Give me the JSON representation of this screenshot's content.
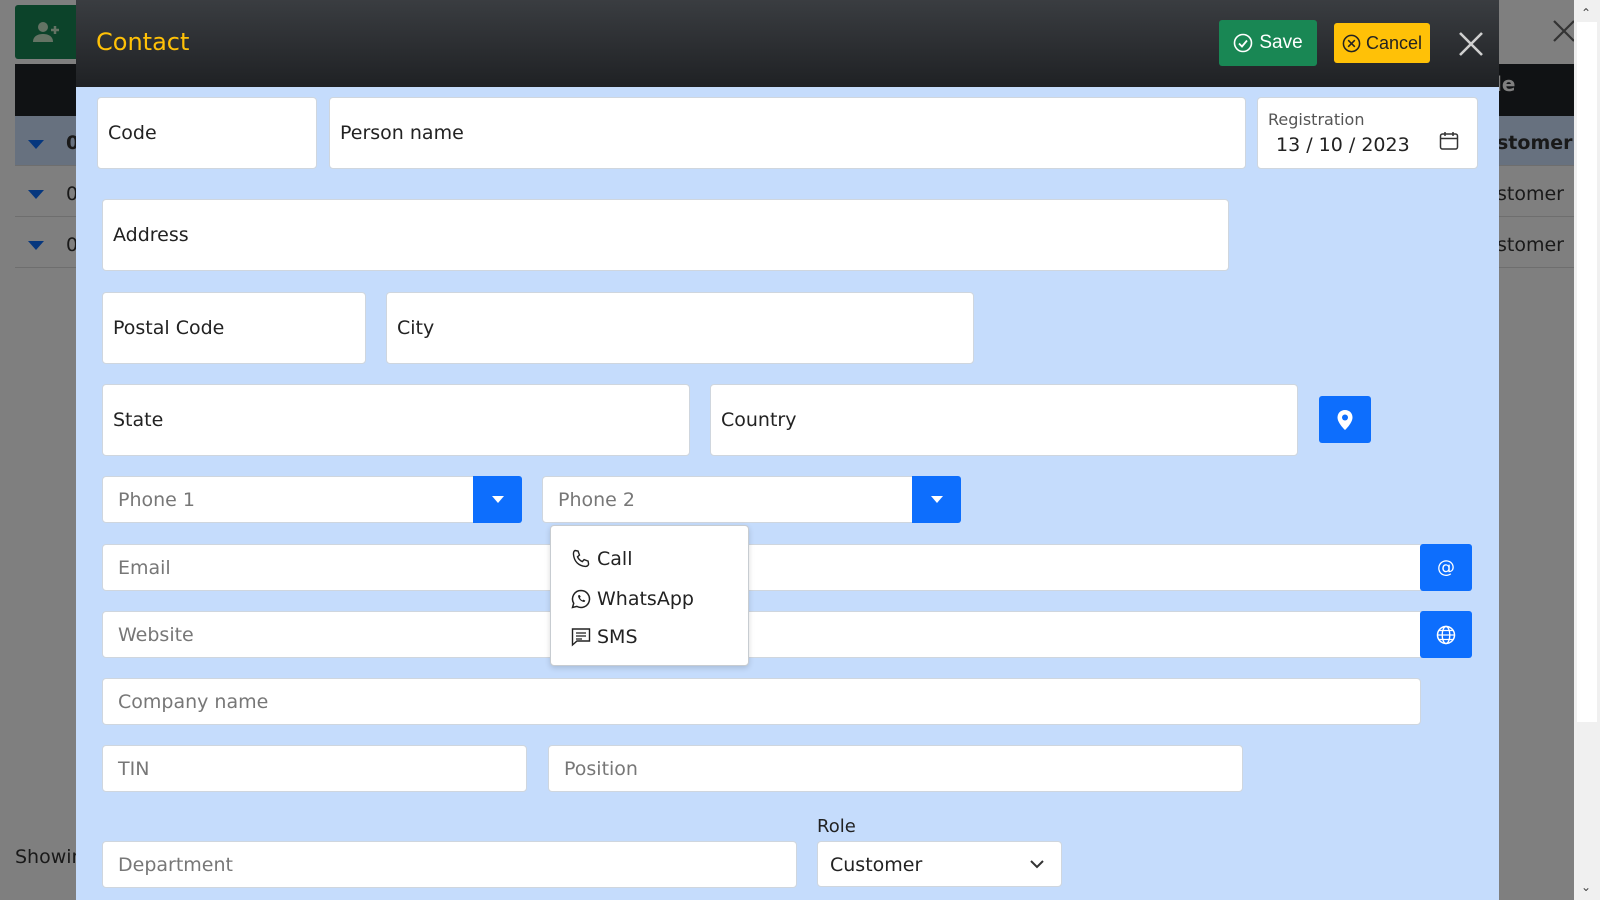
{
  "background": {
    "table_header_partial": "le",
    "rows": [
      {
        "code_partial": "0",
        "role_partial": "stomer",
        "selected": true
      },
      {
        "code_partial": "0",
        "role_partial": "stomer",
        "selected": false
      },
      {
        "code_partial": "0",
        "role_partial": "stomer",
        "selected": false
      }
    ],
    "showing_partial": "Showin"
  },
  "modal": {
    "title": "Contact",
    "save_label": "Save",
    "cancel_label": "Cancel"
  },
  "form": {
    "code": "Code",
    "person_name": "Person name",
    "registration_label": "Registration",
    "registration_value": "13 / 10 / 2023",
    "address": "Address",
    "postal_code": "Postal Code",
    "city": "City",
    "state": "State",
    "country": "Country",
    "phone1": "Phone 1",
    "phone2": "Phone 2",
    "email": "Email",
    "email_button": "@",
    "website": "Website",
    "company": "Company name",
    "tin": "TIN",
    "position": "Position",
    "department": "Department",
    "role_label": "Role",
    "role_value": "Customer"
  },
  "phone_menu": {
    "items": [
      "Call",
      "WhatsApp",
      "SMS"
    ]
  },
  "colors": {
    "modal_body": "#c5dcfc",
    "title": "#ffc107",
    "save": "#198754",
    "cancel": "#ffc107",
    "primary": "#0d6efd"
  },
  "icons": {
    "save": "check-circle-icon",
    "cancel": "x-circle-icon",
    "close": "close-icon",
    "calendar": "calendar-icon",
    "map": "map-pin-icon",
    "dropdown": "caret-down-icon",
    "call": "phone-icon",
    "whatsapp": "whatsapp-icon",
    "sms": "chat-icon",
    "web": "globe-icon",
    "chevron": "chevron-down-icon"
  }
}
